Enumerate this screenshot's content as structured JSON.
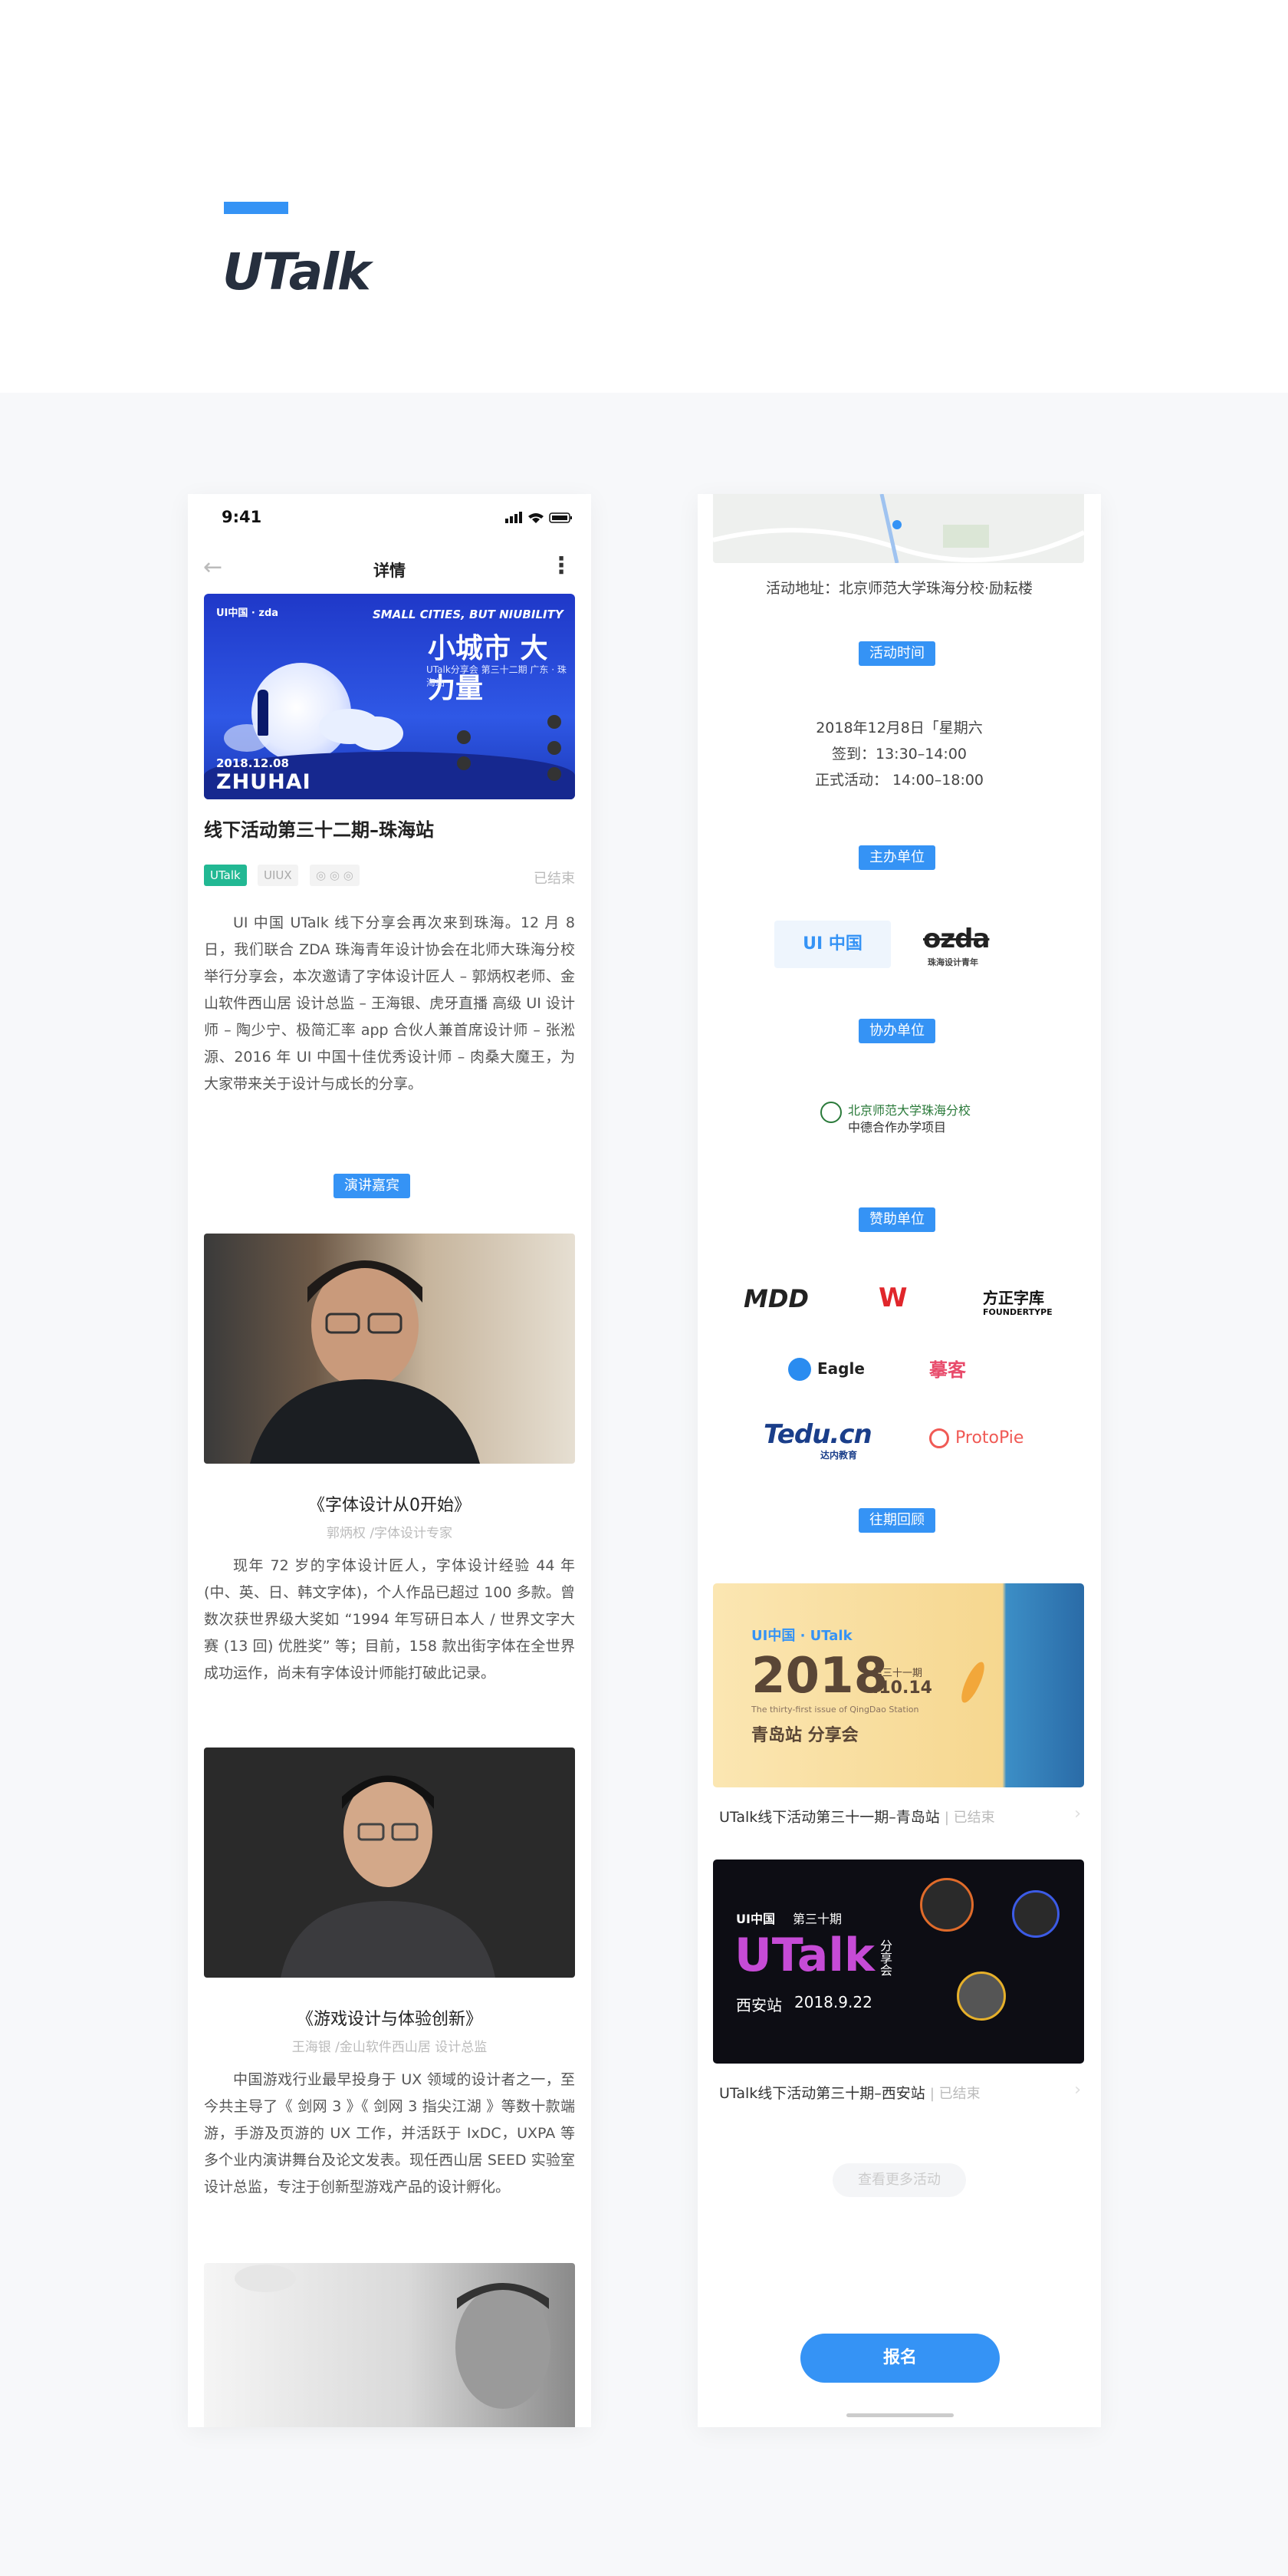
{
  "header": {
    "brand": "UTalk"
  },
  "left": {
    "status_time": "9:41",
    "nav": {
      "back_icon": "arrow-left-icon",
      "title": "详情",
      "more_icon": "more-vertical-icon"
    },
    "banner": {
      "logo": "UI中国 · zda",
      "en": "SMALL CITIES, BUT NIUBILITY",
      "zh": "小城市 大力量",
      "sub": "UTalk分享会 第三十二期 广东 · 珠海站",
      "date": "2018.12.08",
      "city": "ZHUHAI"
    },
    "event_title": "线下活动第三十二期–珠海站",
    "tags": [
      "UTalk",
      "UIUX"
    ],
    "status": "已结束",
    "intro": "UI 中国 UTalk 线下分享会再次来到珠海。12 月 8 日，我们联合 ZDA 珠海青年设计协会在北师大珠海分校举行分享会，本次邀请了字体设计匠人 – 郭炳权老师、金山软件西山居 设计总监 – 王海银、虎牙直播 高级 UI 设计师 – 陶少宁、极简汇率 app 合伙人兼首席设计师 – 张淞源、2016 年 UI 中国十佳优秀设计师 – 肉桑大魔王，为大家带来关于设计与成长的分享。",
    "speakers_label": "演讲嘉宾",
    "talks": [
      {
        "title": "《字体设计从0开始》",
        "speaker": "郭炳权 /字体设计专家",
        "desc": "现年 72 岁的字体设计匠人，字体设计经验 44 年 (中、英、日、韩文字体)，个人作品已超过 100 多款。曾数次获世界级大奖如 “1994 年写研日本人 / 世界文字大赛 (13 回) 优胜奖” 等；目前，158 款出街字体在全世界成功运作，尚未有字体设计师能打破此记录。"
      },
      {
        "title": "《游戏设计与体验创新》",
        "speaker": "王海银 /金山软件西山居 设计总监",
        "desc": "中国游戏行业最早投身于 UX 领域的设计者之一，至今共主导了《 剑网 3 》《 剑网 3 指尖江湖 》等数十款端游，手游及页游的 UX 工作，并活跃于 IxDC，UXPA 等多个业内演讲舞台及论文发表。现任西山居 SEED 实验室设计总监，专注于创新型游戏产品的设计孵化。"
      }
    ]
  },
  "right": {
    "address": "活动地址：北京师范大学珠海分校·励耘楼",
    "time_label": "活动时间",
    "time_lines": [
      "2018年12月8日「星期六",
      "签到：13:30–14:00",
      "正式活动： 14:00–18:00"
    ],
    "host_label": "主办单位",
    "hosts": [
      "UI 中国",
      "ozda",
      "珠海设计青年"
    ],
    "co_label": "协办单位",
    "co": [
      "北京师范大学珠海分校",
      "中德合作办学项目"
    ],
    "sponsor_label": "赞助单位",
    "sponsors": [
      "MDD",
      "W",
      "方正字库",
      "FOUNDERTYPE",
      "Eagle",
      "摹客",
      "Tedu.cn",
      "达内教育",
      "ProtoPie"
    ],
    "past_label": "往期回顾",
    "past": [
      {
        "title": "UTalk线下活动第三十一期–青岛站",
        "status": "已结束",
        "card": {
          "brand": "UI中国 · UTalk",
          "year": "2018",
          "issue": "第三十一期",
          "date": ".10.14",
          "en": "The thirty-first issue of QingDao Station",
          "city": "青岛站 分享会"
        }
      },
      {
        "title": "UTalk线下活动第三十期–西安站",
        "status": "已结束",
        "card": {
          "brand": "UI中国",
          "issue": "第三十期",
          "word": "UTalk",
          "share": "分享会",
          "city": "西安站",
          "date": "2018.9.22"
        }
      }
    ],
    "more": "查看更多活动",
    "signup": "报名"
  },
  "colors": {
    "accent": "#3593f5",
    "tag": "#22b893"
  }
}
